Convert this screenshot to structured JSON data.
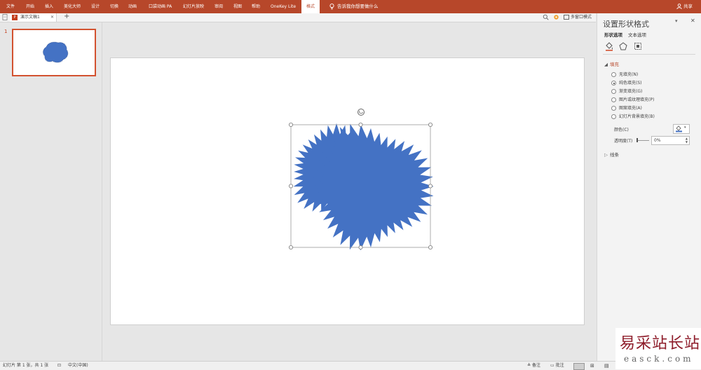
{
  "ribbon": {
    "tabs": [
      {
        "label": "文件"
      },
      {
        "label": "开始"
      },
      {
        "label": "插入"
      },
      {
        "label": "美化大师"
      },
      {
        "label": "设计"
      },
      {
        "label": "切换"
      },
      {
        "label": "动画"
      },
      {
        "label": "口袋动画 PA"
      },
      {
        "label": "幻灯片放映"
      },
      {
        "label": "审阅"
      },
      {
        "label": "视图"
      },
      {
        "label": "帮助"
      },
      {
        "label": "OneKey Lite"
      },
      {
        "label": "格式"
      }
    ],
    "tell_me": "告诉我你想要做什么",
    "share": "共享"
  },
  "doc_tabs": {
    "active_tab": "演示文稿1",
    "icon_letter": "P",
    "multi_window": "多窗口模式"
  },
  "thumbnails": {
    "slide_number": "1"
  },
  "format_pane": {
    "title": "设置形状格式",
    "tab_shape_options": "形状选项",
    "tab_text_options": "文本选项",
    "fill_section": "填充",
    "fill_options": [
      {
        "label": "无填充(N)"
      },
      {
        "label": "纯色填充(S)"
      },
      {
        "label": "渐变填充(G)"
      },
      {
        "label": "图片或纹理填充(P)"
      },
      {
        "label": "图案填充(A)"
      },
      {
        "label": "幻灯片背景填充(B)"
      }
    ],
    "selected_fill": "纯色填充(S)",
    "color_label": "颜色(C)",
    "transparency_label": "透明度(T)",
    "transparency_value": "0%",
    "line_section": "线条"
  },
  "shape": {
    "fill_color": "#4472c4"
  },
  "status": {
    "slide_info": "幻灯片 第 1 张，共 1 张",
    "language": "中文(中国)",
    "notes": "备注",
    "comments": "批注"
  },
  "watermark": {
    "text": "易采站长站",
    "url": "easck.com"
  },
  "colors": {
    "ribbon": "#b7472a",
    "accent": "#d35230"
  }
}
